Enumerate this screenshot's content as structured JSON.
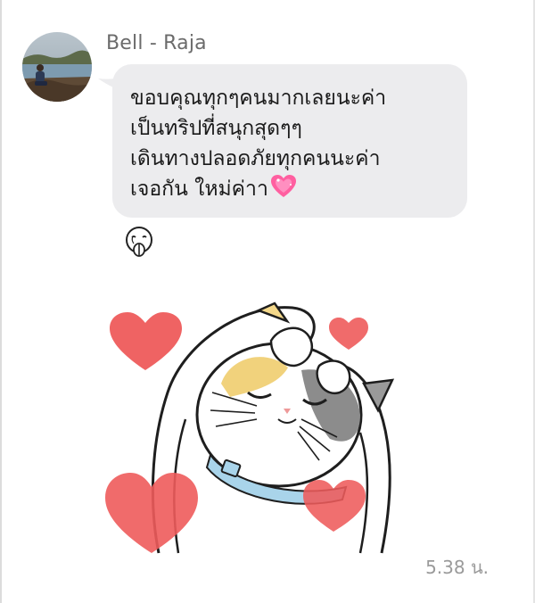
{
  "chat": {
    "sender_name": "Bell - Raja",
    "message_lines": [
      "ขอบคุณทุกๆคนมากเลยนะค่า",
      "เป็นทริปที่สนุกสุดๆๆ",
      "เดินทางปลอดภัยทุกคนนะค่า",
      "เจอกัน ใหม่ค่าา"
    ],
    "message_emoji": "sparkling-heart-icon",
    "reaction_icon": "praying-face-reaction-icon",
    "sticker_name": "cat-hearts-sticker",
    "timestamp": "5.38 น."
  },
  "colors": {
    "bubble": "#ececee",
    "sender_text": "#6b6b6b",
    "timestamp_text": "#9a9a9a",
    "sticker_heart": "#ee5b5b",
    "emoji_heart": "#ff5fa0",
    "cat_collar": "#a9d4ea"
  }
}
